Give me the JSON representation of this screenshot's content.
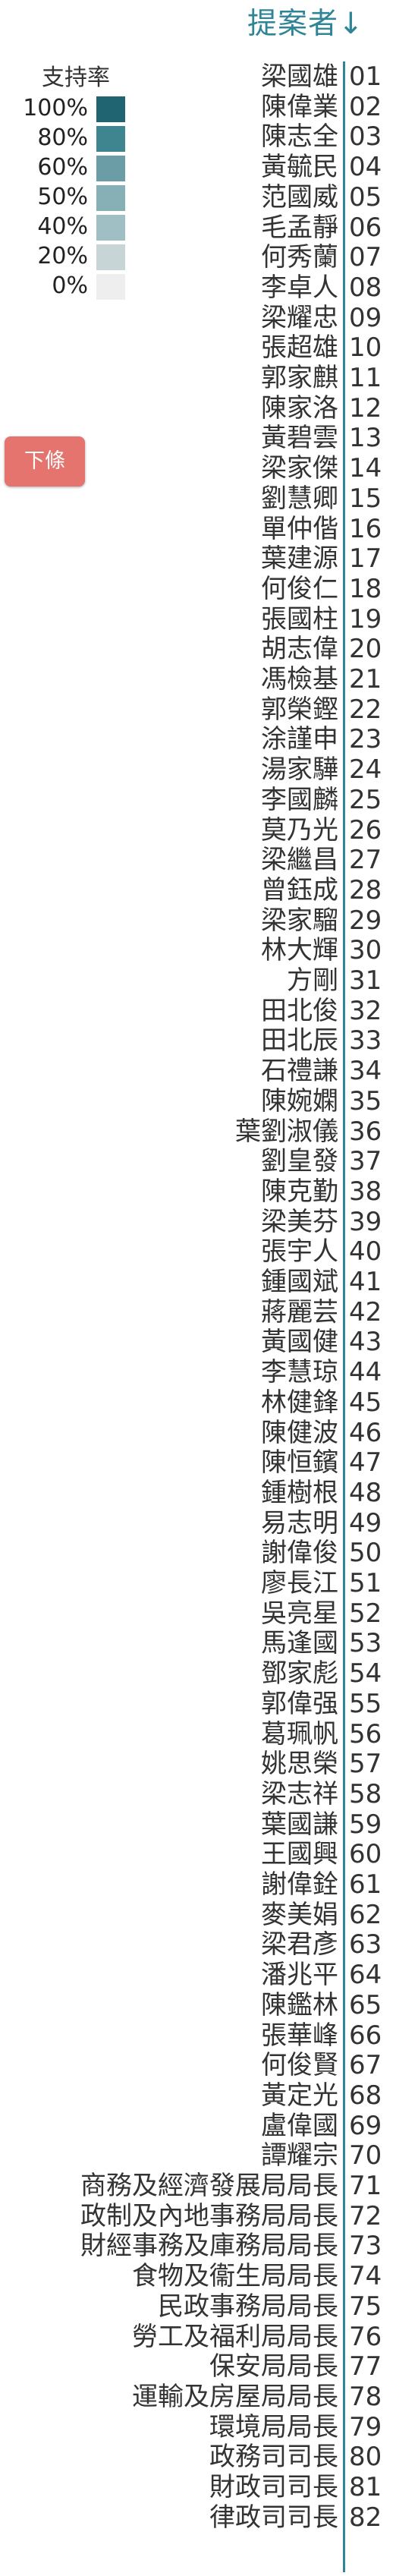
{
  "header": {
    "title": "提案者↓"
  },
  "legend": {
    "title": "支持率",
    "items": [
      {
        "label": "100%",
        "color": "#1f6470"
      },
      {
        "label": "80%",
        "color": "#3f8590"
      },
      {
        "label": "60%",
        "color": "#6b9da6"
      },
      {
        "label": "50%",
        "color": "#86b0b6"
      },
      {
        "label": "40%",
        "color": "#a0bfc4"
      },
      {
        "label": "20%",
        "color": "#c7d5d7"
      },
      {
        "label": "0%",
        "color": "#eeeeee"
      }
    ]
  },
  "button": {
    "label": "下條"
  },
  "proposers": [
    {
      "name": "梁國雄",
      "number": "01"
    },
    {
      "name": "陳偉業",
      "number": "02"
    },
    {
      "name": "陳志全",
      "number": "03"
    },
    {
      "name": "黃毓民",
      "number": "04"
    },
    {
      "name": "范國威",
      "number": "05"
    },
    {
      "name": "毛孟靜",
      "number": "06"
    },
    {
      "name": "何秀蘭",
      "number": "07"
    },
    {
      "name": "李卓人",
      "number": "08"
    },
    {
      "name": "梁耀忠",
      "number": "09"
    },
    {
      "name": "張超雄",
      "number": "10"
    },
    {
      "name": "郭家麒",
      "number": "11"
    },
    {
      "name": "陳家洛",
      "number": "12"
    },
    {
      "name": "黃碧雲",
      "number": "13"
    },
    {
      "name": "梁家傑",
      "number": "14"
    },
    {
      "name": "劉慧卿",
      "number": "15"
    },
    {
      "name": "單仲偕",
      "number": "16"
    },
    {
      "name": "葉建源",
      "number": "17"
    },
    {
      "name": "何俊仁",
      "number": "18"
    },
    {
      "name": "張國柱",
      "number": "19"
    },
    {
      "name": "胡志偉",
      "number": "20"
    },
    {
      "name": "馮檢基",
      "number": "21"
    },
    {
      "name": "郭榮鏗",
      "number": "22"
    },
    {
      "name": "涂謹申",
      "number": "23"
    },
    {
      "name": "湯家驊",
      "number": "24"
    },
    {
      "name": "李國麟",
      "number": "25"
    },
    {
      "name": "莫乃光",
      "number": "26"
    },
    {
      "name": "梁繼昌",
      "number": "27"
    },
    {
      "name": "曾鈺成",
      "number": "28"
    },
    {
      "name": "梁家騮",
      "number": "29"
    },
    {
      "name": "林大輝",
      "number": "30"
    },
    {
      "name": "方剛",
      "number": "31"
    },
    {
      "name": "田北俊",
      "number": "32"
    },
    {
      "name": "田北辰",
      "number": "33"
    },
    {
      "name": "石禮謙",
      "number": "34"
    },
    {
      "name": "陳婉嫻",
      "number": "35"
    },
    {
      "name": "葉劉淑儀",
      "number": "36"
    },
    {
      "name": "劉皇發",
      "number": "37"
    },
    {
      "name": "陳克勤",
      "number": "38"
    },
    {
      "name": "梁美芬",
      "number": "39"
    },
    {
      "name": "張宇人",
      "number": "40"
    },
    {
      "name": "鍾國斌",
      "number": "41"
    },
    {
      "name": "蔣麗芸",
      "number": "42"
    },
    {
      "name": "黃國健",
      "number": "43"
    },
    {
      "name": "李慧琼",
      "number": "44"
    },
    {
      "name": "林健鋒",
      "number": "45"
    },
    {
      "name": "陳健波",
      "number": "46"
    },
    {
      "name": "陳恒鑌",
      "number": "47"
    },
    {
      "name": "鍾樹根",
      "number": "48"
    },
    {
      "name": "易志明",
      "number": "49"
    },
    {
      "name": "謝偉俊",
      "number": "50"
    },
    {
      "name": "廖長江",
      "number": "51"
    },
    {
      "name": "吳亮星",
      "number": "52"
    },
    {
      "name": "馬逢國",
      "number": "53"
    },
    {
      "name": "鄧家彪",
      "number": "54"
    },
    {
      "name": "郭偉强",
      "number": "55"
    },
    {
      "name": "葛珮帆",
      "number": "56"
    },
    {
      "name": "姚思榮",
      "number": "57"
    },
    {
      "name": "梁志祥",
      "number": "58"
    },
    {
      "name": "葉國謙",
      "number": "59"
    },
    {
      "name": "王國興",
      "number": "60"
    },
    {
      "name": "謝偉銓",
      "number": "61"
    },
    {
      "name": "麥美娟",
      "number": "62"
    },
    {
      "name": "梁君彥",
      "number": "63"
    },
    {
      "name": "潘兆平",
      "number": "64"
    },
    {
      "name": "陳鑑林",
      "number": "65"
    },
    {
      "name": "張華峰",
      "number": "66"
    },
    {
      "name": "何俊賢",
      "number": "67"
    },
    {
      "name": "黃定光",
      "number": "68"
    },
    {
      "name": "盧偉國",
      "number": "69"
    },
    {
      "name": "譚耀宗",
      "number": "70"
    },
    {
      "name": "商務及經濟發展局局長",
      "number": "71"
    },
    {
      "name": "政制及內地事務局局長",
      "number": "72"
    },
    {
      "name": "財經事務及庫務局局長",
      "number": "73"
    },
    {
      "name": "食物及衞生局局長",
      "number": "74"
    },
    {
      "name": "民政事務局局長",
      "number": "75"
    },
    {
      "name": "勞工及福利局局長",
      "number": "76"
    },
    {
      "name": "保安局局長",
      "number": "77"
    },
    {
      "name": "運輸及房屋局局長",
      "number": "78"
    },
    {
      "name": "環境局局長",
      "number": "79"
    },
    {
      "name": "政務司司長",
      "number": "80"
    },
    {
      "name": "財政司司長",
      "number": "81"
    },
    {
      "name": "律政司司長",
      "number": "82"
    }
  ]
}
